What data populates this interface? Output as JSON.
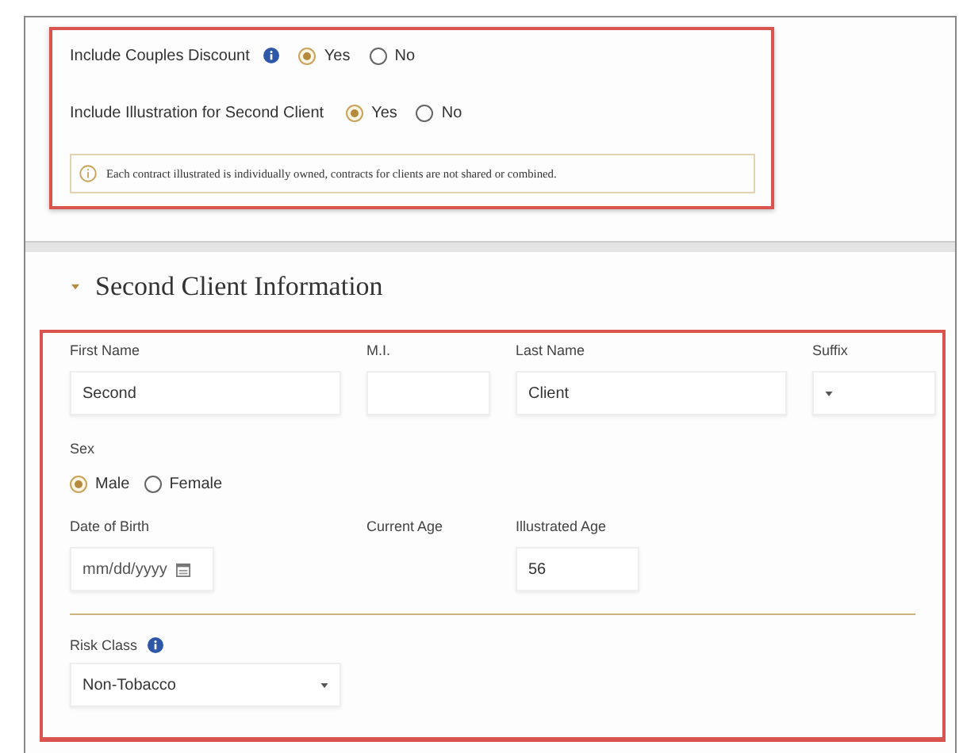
{
  "top_options": [
    {
      "label": "Include Couples Discount",
      "info": true,
      "options": [
        {
          "label": "Yes",
          "selected": true
        },
        {
          "label": "No",
          "selected": false
        }
      ]
    },
    {
      "label": "Include Illustration for Second Client",
      "info": false,
      "options": [
        {
          "label": "Yes",
          "selected": true
        },
        {
          "label": "No",
          "selected": false
        }
      ]
    }
  ],
  "notice": {
    "text": "Each contract illustrated is individually owned, contracts for clients are not shared or combined."
  },
  "section": {
    "title": "Second Client Information"
  },
  "name_fields": [
    {
      "label": "First Name",
      "kind": "text",
      "value": "Second"
    },
    {
      "label": "M.I.",
      "kind": "text"
    },
    {
      "label": "Last Name",
      "kind": "text",
      "value": "Client"
    },
    {
      "label": "Suffix",
      "kind": "select"
    }
  ],
  "sex": {
    "label": "Sex",
    "options": [
      {
        "label": "Male",
        "selected": true
      },
      {
        "label": "Female",
        "selected": false
      }
    ]
  },
  "age_fields": [
    {
      "label": "Date of Birth",
      "kind": "date",
      "placeholder": "mm/dd/yyyy"
    },
    {
      "label": "Current Age",
      "kind": "empty"
    },
    {
      "label": "Illustrated Age",
      "kind": "text",
      "value": "56"
    }
  ],
  "risk_class": {
    "label": "Risk Class",
    "info": true,
    "value": "Non-Tobacco"
  }
}
